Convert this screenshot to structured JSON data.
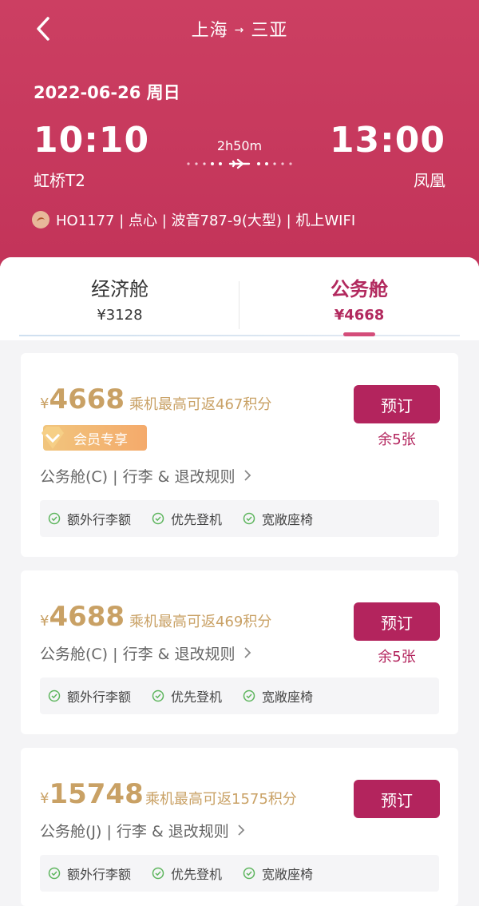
{
  "header": {
    "origin": "上海",
    "destination": "三亚",
    "route_arrow": "→",
    "date": "2022-06-26 周日",
    "departure": {
      "time": "10:10",
      "airport": "虹桥T2"
    },
    "arrival": {
      "time": "13:00",
      "airport": "凤凰"
    },
    "duration": "2h50m",
    "flight_info": "HO1177 | 点心 | 波音787-9(大型) | 机上WIFI",
    "colors": {
      "background": "#c8385e"
    }
  },
  "tabs": [
    {
      "name": "经济舱",
      "price": "¥3128",
      "active": false
    },
    {
      "name": "公务舱",
      "price": "¥4668",
      "active": true
    }
  ],
  "offers": [
    {
      "currency": "¥",
      "price": "4668",
      "points": "乘机最高可返467积分",
      "badge": "会员专享",
      "rules": "公务舱(C) | 行李 & 退改规则",
      "remaining": "余5张",
      "book_label": "预订",
      "perks": [
        "额外行李额",
        "优先登机",
        "宽敞座椅"
      ]
    },
    {
      "currency": "¥",
      "price": "4688",
      "points": "乘机最高可返469积分",
      "rules": "公务舱(C) | 行李 & 退改规则",
      "remaining": "余5张",
      "book_label": "预订",
      "perks": [
        "额外行李额",
        "优先登机",
        "宽敞座椅"
      ]
    },
    {
      "currency": "¥",
      "price": "15748",
      "points": "乘机最高可返1575积分",
      "rules": "公务舱(J) | 行李 & 退改规则",
      "book_label": "预订",
      "perks": [
        "额外行李额",
        "优先登机",
        "宽敞座椅"
      ]
    }
  ],
  "icons": {
    "back": "chevron-left-icon",
    "plane": "plane-icon",
    "airline_logo": "airline-logo-icon",
    "check": "check-circle-icon",
    "rules_arrow": "chevron-right-icon"
  }
}
